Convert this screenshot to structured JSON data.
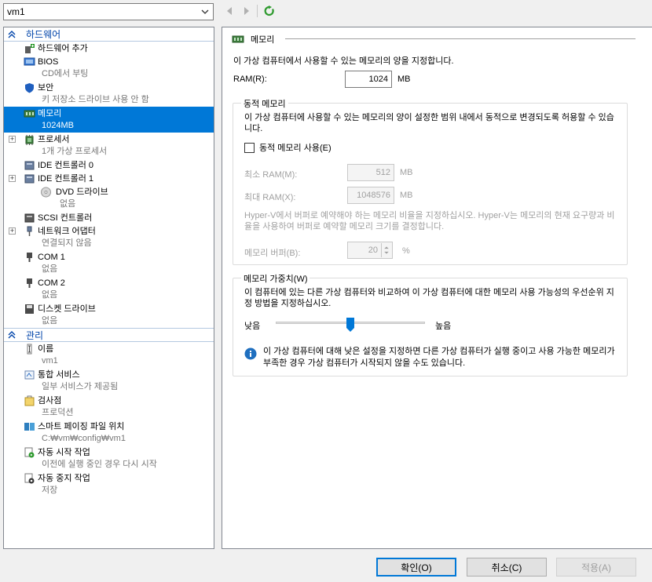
{
  "toolbar": {
    "vm_name": "vm1",
    "colors": {
      "refresh": "#2e9a2e",
      "nav_disabled": "#a0a0a0"
    }
  },
  "hardware_section": "하드웨어",
  "management_section": "관리",
  "hardware_items": [
    {
      "name": "하드웨어 추가",
      "sub": "",
      "icon": "add-hardware-icon"
    },
    {
      "name": "BIOS",
      "sub": "CD에서 부팅",
      "icon": "bios-icon"
    },
    {
      "name": "보안",
      "sub": "키 저장소 드라이브 사용 안 함",
      "icon": "shield-icon"
    },
    {
      "name": "메모리",
      "sub": "1024MB",
      "icon": "memory-icon",
      "selected": true
    },
    {
      "name": "프로세서",
      "sub": "1개 가상 프로세서",
      "icon": "processor-icon"
    },
    {
      "name": "IDE 컨트롤러 0",
      "sub": "",
      "icon": "ide-controller-icon"
    },
    {
      "name": "IDE 컨트롤러 1",
      "sub": "",
      "icon": "ide-controller-icon"
    },
    {
      "name": "DVD 드라이브",
      "sub": "없음",
      "icon": "dvd-icon"
    },
    {
      "name": "SCSI 컨트롤러",
      "sub": "",
      "icon": "scsi-controller-icon"
    },
    {
      "name": "네트워크 어댑터",
      "sub": "연결되지 않음",
      "icon": "network-adapter-icon"
    },
    {
      "name": "COM 1",
      "sub": "없음",
      "icon": "com-port-icon"
    },
    {
      "name": "COM 2",
      "sub": "없음",
      "icon": "com-port-icon"
    },
    {
      "name": "디스켓 드라이브",
      "sub": "없음",
      "icon": "diskette-icon"
    }
  ],
  "management_items": [
    {
      "name": "이름",
      "sub": "vm1",
      "icon": "name-icon"
    },
    {
      "name": "통합 서비스",
      "sub": "일부 서비스가 제공됨",
      "icon": "integration-services-icon"
    },
    {
      "name": "검사점",
      "sub": "프로덕션",
      "icon": "checkpoint-icon"
    },
    {
      "name": "스마트 페이징 파일 위치",
      "sub": "C:₩vm₩config₩vm1",
      "icon": "smart-paging-icon"
    },
    {
      "name": "자동 시작 작업",
      "sub": "이전에 실행 중인 경우 다시 시작",
      "icon": "auto-start-icon"
    },
    {
      "name": "자동 중지 작업",
      "sub": "저장",
      "icon": "auto-stop-icon"
    }
  ],
  "memory_panel": {
    "title": "메모리",
    "description": "이 가상 컴퓨터에서 사용할 수 있는 메모리의 양을 지정합니다.",
    "ram_label": "RAM(R):",
    "ram_value": "1024",
    "ram_unit": "MB",
    "dynamic": {
      "title": "동적 메모리",
      "description": "이 가상 컴퓨터에 사용할 수 있는 메모리의 양이 설정한 범위 내에서 동적으로 변경되도록 허용할 수 있습니다.",
      "enable_label": "동적 메모리 사용(E)",
      "enabled": false,
      "min_label": "최소 RAM(M):",
      "min_value": "512",
      "max_label": "최대 RAM(X):",
      "max_value": "1048576",
      "unit": "MB",
      "buffer_desc": "Hyper-V에서 버퍼로 예약해야 하는 메모리 비율을 지정하십시오. Hyper-V는 메모리의 현재 요구량과 비율을 사용하여 버퍼로 예약할 메모리 크기를 결정합니다.",
      "buffer_label": "메모리 버퍼(B):",
      "buffer_value": "20",
      "buffer_unit": "%"
    },
    "weight": {
      "title": "메모리 가중치(W)",
      "description": "이 컴퓨터에 있는 다른 가상 컴퓨터와 비교하여 이 가상 컴퓨터에 대한 메모리 사용 가능성의 우선순위 지정 방법을 지정하십시오.",
      "low_label": "낮음",
      "high_label": "높음",
      "slider_fraction": 0.5,
      "info_text": "이 가상 컴퓨터에 대해 낮은 설정을 지정하면 다른 가상 컴퓨터가 실행 중이고 사용 가능한 메모리가 부족한 경우 가상 컴퓨터가 시작되지 않을 수도 있습니다."
    }
  },
  "buttons": {
    "ok": "확인(O)",
    "cancel": "취소(C)",
    "apply": "적용(A)"
  }
}
